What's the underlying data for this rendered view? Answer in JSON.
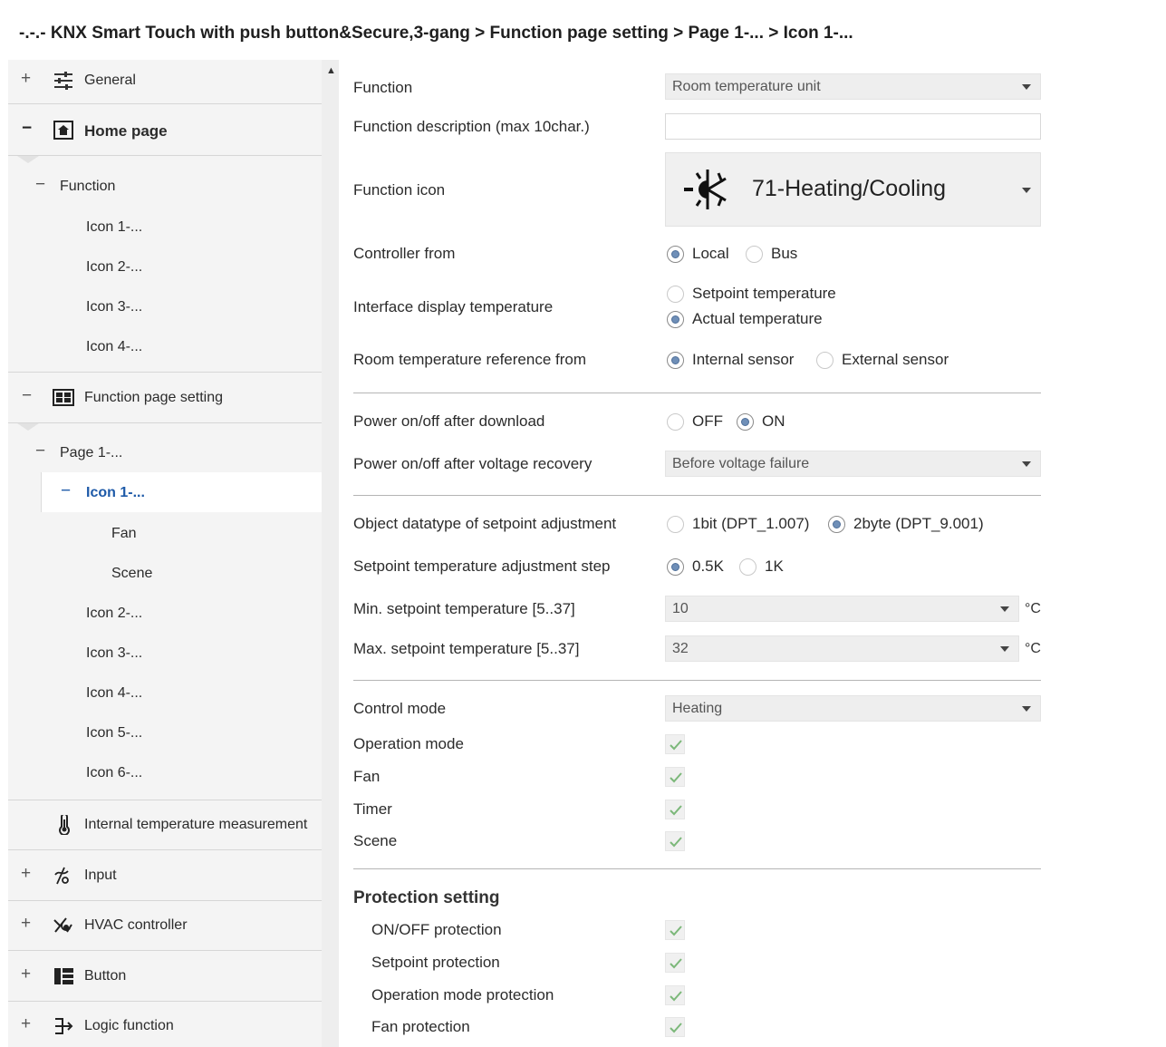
{
  "breadcrumb": "-.-.- KNX Smart Touch with push button&Secure,3-gang > Function page setting > Page 1-... > Icon 1-...",
  "sidebar": {
    "items": [
      {
        "label": "General",
        "expander": "+"
      },
      {
        "label": "Home page",
        "expander": "−"
      },
      {
        "label": "Function",
        "expander": "−"
      },
      {
        "label": "Icon 1-..."
      },
      {
        "label": "Icon 2-..."
      },
      {
        "label": "Icon 3-..."
      },
      {
        "label": "Icon 4-..."
      },
      {
        "label": "Function page setting",
        "expander": "−"
      },
      {
        "label": "Page 1-...",
        "expander": "−"
      },
      {
        "label": "Icon 1-...",
        "expander": "−"
      },
      {
        "label": "Fan"
      },
      {
        "label": "Scene"
      },
      {
        "label": "Icon 2-..."
      },
      {
        "label": "Icon 3-..."
      },
      {
        "label": "Icon 4-..."
      },
      {
        "label": "Icon 5-..."
      },
      {
        "label": "Icon 6-..."
      },
      {
        "label": "Internal temperature measurement"
      },
      {
        "label": "Input",
        "expander": "+"
      },
      {
        "label": "HVAC controller",
        "expander": "+"
      },
      {
        "label": "Button",
        "expander": "+"
      },
      {
        "label": "Logic function",
        "expander": "+"
      }
    ]
  },
  "form": {
    "function": {
      "label": "Function",
      "value": "Room temperature unit"
    },
    "description": {
      "label": "Function description (max 10char.)",
      "value": ""
    },
    "icon": {
      "label": "Function icon",
      "value": "71-Heating/Cooling"
    },
    "controller_from": {
      "label": "Controller from",
      "options": [
        "Local",
        "Bus"
      ],
      "selected": "Local"
    },
    "display_temp": {
      "label": "Interface display temperature",
      "options": [
        "Setpoint temperature",
        "Actual temperature"
      ],
      "selected": "Actual temperature"
    },
    "ref_from": {
      "label": "Room temperature reference from",
      "options": [
        "Internal sensor",
        "External sensor"
      ],
      "selected": "Internal sensor"
    },
    "power_download": {
      "label": "Power on/off after download",
      "options": [
        "OFF",
        "ON"
      ],
      "selected": "ON"
    },
    "power_recovery": {
      "label": "Power on/off after voltage recovery",
      "value": "Before voltage failure"
    },
    "datatype": {
      "label": "Object datatype of setpoint adjustment",
      "options": [
        "1bit (DPT_1.007)",
        "2byte (DPT_9.001)"
      ],
      "selected": "2byte (DPT_9.001)"
    },
    "step": {
      "label": "Setpoint temperature adjustment step",
      "options": [
        "0.5K",
        "1K"
      ],
      "selected": "0.5K"
    },
    "min_setpoint": {
      "label": "Min. setpoint temperature [5..37]",
      "value": "10",
      "unit": "°C"
    },
    "max_setpoint": {
      "label": "Max. setpoint temperature [5..37]",
      "value": "32",
      "unit": "°C"
    },
    "control_mode": {
      "label": "Control mode",
      "value": "Heating"
    },
    "operation_mode": {
      "label": "Operation mode",
      "checked": true
    },
    "fan": {
      "label": "Fan",
      "checked": true
    },
    "timer": {
      "label": "Timer",
      "checked": true
    },
    "scene": {
      "label": "Scene",
      "checked": true
    },
    "protection": {
      "title": "Protection setting",
      "onoff": {
        "label": "ON/OFF protection",
        "checked": true
      },
      "setpoint": {
        "label": "Setpoint protection",
        "checked": true
      },
      "opmode": {
        "label": "Operation mode protection",
        "checked": true
      },
      "fan": {
        "label": "Fan protection",
        "checked": true
      }
    }
  },
  "colors": {
    "accent": "#1e5aa8",
    "sidebar_bg": "#f4f4f4",
    "check": "#7cb87a"
  }
}
